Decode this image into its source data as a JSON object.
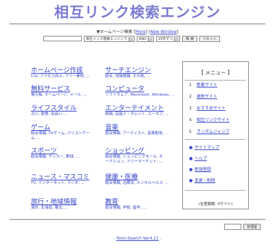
{
  "title": "相互リンク検索エンジン",
  "search": {
    "mark": "▼",
    "label": "ホームページ検索",
    "more": "More",
    "new_window": "New Window",
    "engine_select": "相互リンク検索エンジンで",
    "andor_select": "AND",
    "per_page_select": "25件ずつ",
    "search_button": "検 索",
    "reset_button": "リセット"
  },
  "categories": [
    {
      "title": "ホームページ作成",
      "subs": "CGI, アクセス向上, フリー素材, ..."
    },
    {
      "title": "無料サービス",
      "subs": "掲示板, ホームページ, メール, ..."
    },
    {
      "title": "ライフスタイル",
      "subs": "占い, 飲食, 出会い, ..."
    },
    {
      "title": "ゲーム",
      "subs": "総合情報, TVゲーム, パソコンゲーム, ..."
    },
    {
      "title": "スポーツ",
      "subs": "総合情報, サッカー, 野球, ..."
    },
    {
      "title": "ニュース・マスコミ",
      "subs": "TV, インターネット, ラジオ, ..."
    },
    {
      "title": "旅行・地域情報",
      "subs": "海外, 北海道, 東北, ..."
    },
    {
      "title": "サーチエンジン",
      "subs": "総合, 地域情報, その他, ..."
    },
    {
      "title": "コンピュータ",
      "subs": "ソフトウェア, Macintosh, Windows, ..."
    },
    {
      "title": "エンターテイメント",
      "subs": "映画, 芸能人・タレント, ユーモア, ..."
    },
    {
      "title": "音楽",
      "subs": "総合情報, アーティスト, 音楽配信, ..."
    },
    {
      "title": "ショッピング",
      "subs": "総合情報, ショッピングモール, オークション, フリーマーケット, ..."
    },
    {
      "title": "健康・医療",
      "subs": "総合情報, 治療法, メンタルヘルス, ..."
    },
    {
      "title": "教育",
      "subs": "総合情報, 学校, 留学, ..."
    }
  ],
  "menu": {
    "title": "【 メニュー 】",
    "numbered": [
      {
        "n": "1",
        "label": "新着サイト"
      },
      {
        "n": "2",
        "label": "更新サイト"
      },
      {
        "n": "3",
        "label": "おすすめサイト"
      },
      {
        "n": "4",
        "label": "相互リンクサイト"
      },
      {
        "n": "5",
        "label": "ランダムジャンプ"
      }
    ],
    "bullet": "●",
    "bulleted": [
      "サイトマップ",
      "ヘルプ",
      "新規登録",
      "変更・削除"
    ],
    "count": "(全登録数: 0サイト)"
  },
  "admin": {
    "button": "管理室"
  },
  "footer": {
    "text": "Yomi-Search Ver4.21",
    "dash": "-"
  }
}
